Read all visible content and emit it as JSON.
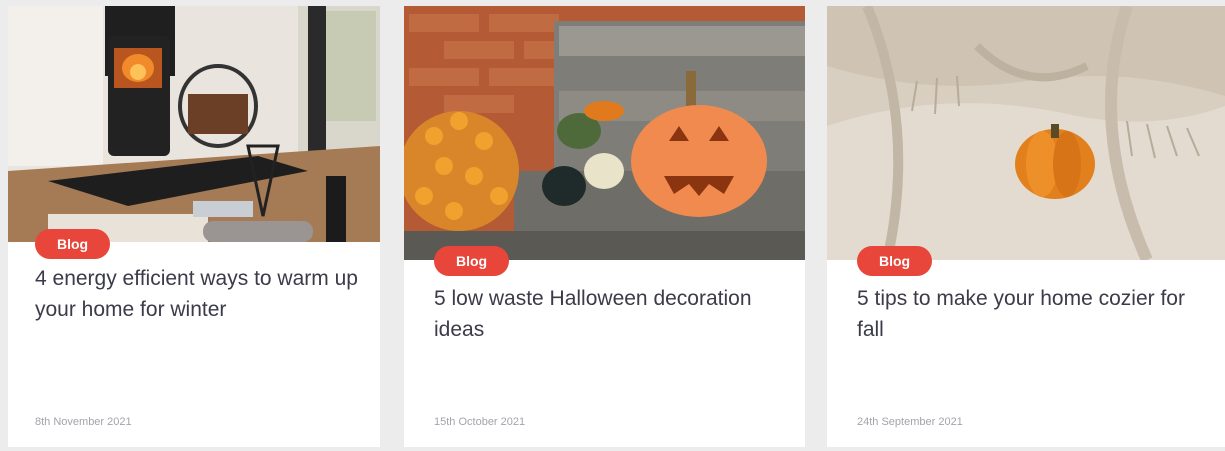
{
  "cards": [
    {
      "badge": "Blog",
      "title": "4 energy efficient ways to warm up your home for winter",
      "date": "8th November 2021",
      "image": "wood-burning-stove-photo"
    },
    {
      "badge": "Blog",
      "title": "5 low waste Halloween decoration ideas",
      "date": "15th October 2021",
      "image": "halloween-pumpkins-photo"
    },
    {
      "badge": "Blog",
      "title": "5 tips to make your home cozier for fall",
      "date": "24th September 2021",
      "image": "pumpkin-on-blanket-photo"
    }
  ],
  "colors": {
    "badge_bg": "#e8463a",
    "title_text": "#3b3b4a",
    "date_text": "#a3a3ab"
  }
}
